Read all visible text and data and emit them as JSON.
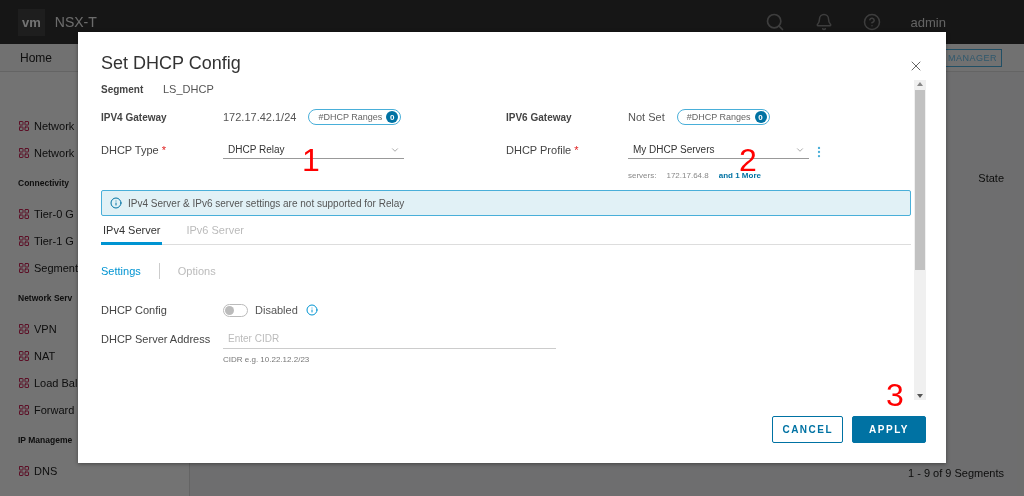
{
  "app": {
    "logo": "vm",
    "title": "NSX-T",
    "user": "admin",
    "nav_home": "Home",
    "mode_button": "MANAGER",
    "table_header": "State",
    "table_footer": "1 - 9 of 9 Segments"
  },
  "sidebar": [
    {
      "kind": "item",
      "label": "Network"
    },
    {
      "kind": "item",
      "label": "Network"
    },
    {
      "kind": "section",
      "label": "Connectivity"
    },
    {
      "kind": "item",
      "label": "Tier-0 G"
    },
    {
      "kind": "item",
      "label": "Tier-1 G"
    },
    {
      "kind": "item",
      "label": "Segment"
    },
    {
      "kind": "section",
      "label": "Network Serv"
    },
    {
      "kind": "item",
      "label": "VPN"
    },
    {
      "kind": "item",
      "label": "NAT"
    },
    {
      "kind": "item",
      "label": "Load Bal"
    },
    {
      "kind": "item",
      "label": "Forward"
    },
    {
      "kind": "section",
      "label": "IP Manageme"
    },
    {
      "kind": "item",
      "label": "DNS"
    }
  ],
  "dialog": {
    "title": "Set DHCP Config",
    "segment": {
      "label": "Segment",
      "value": "LS_DHCP"
    },
    "gateways": [
      {
        "label": "IPV4 Gateway",
        "value": "172.17.42.1/24",
        "ranges_label": "#DHCP Ranges",
        "count": "0"
      },
      {
        "label": "IPV6 Gateway",
        "value": "Not Set",
        "ranges_label": "#DHCP Ranges",
        "count": "0"
      }
    ],
    "dhcp_type": {
      "label": "DHCP Type",
      "required_mark": "*",
      "value": "DHCP Relay"
    },
    "dhcp_profile": {
      "label": "DHCP Profile",
      "required_mark": "*",
      "value": "My DHCP Servers",
      "servers_label": "servers:",
      "server": "172.17.64.8",
      "more_link": "and 1 More"
    },
    "info": "IPv4 Server & IPv6 server settings are not supported for Relay",
    "tabs": [
      {
        "label": "IPv4 Server",
        "selected": true
      },
      {
        "label": "IPv6 Server",
        "selected": false
      }
    ],
    "subtabs": [
      {
        "label": "Settings",
        "selected": true
      },
      {
        "label": "Options",
        "selected": false
      }
    ],
    "dhcp_config": {
      "label": "DHCP Config",
      "on": false,
      "state_text": "Disabled"
    },
    "server_address": {
      "label": "DHCP Server Address",
      "placeholder": "Enter CIDR",
      "hint": "CIDR e.g. 10.22.12.2/23"
    },
    "buttons": {
      "cancel": "CANCEL",
      "apply": "APPLY"
    }
  },
  "annotations": [
    "1",
    "2",
    "3"
  ]
}
